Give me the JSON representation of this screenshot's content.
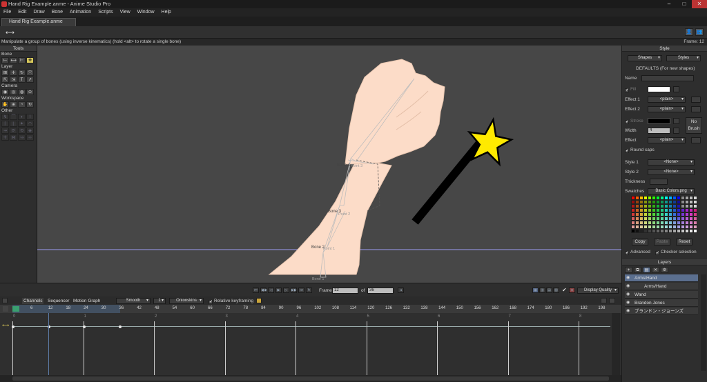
{
  "window": {
    "title": "Hand Rig Example.anme - Anime Studio Pro",
    "minimize": "–",
    "maximize": "□",
    "close": "✕"
  },
  "menu": [
    "File",
    "Edit",
    "Draw",
    "Bone",
    "Animation",
    "Scripts",
    "View",
    "Window",
    "Help"
  ],
  "doc_tab": "Hand Rig Example.anme",
  "status": {
    "message": "Manipulate a group of bones (using inverse kinematics) (hold <alt> to rotate a single bone)",
    "frame": "Frame: 12"
  },
  "tools": {
    "header": "Tools",
    "groups": [
      {
        "label": "Bone",
        "icons": [
          "⟝",
          "⟷",
          "⊢",
          "✥"
        ],
        "selected": 3
      },
      {
        "label": "Layer",
        "icons": [
          "⊞",
          "✛",
          "↻",
          "⤧",
          "⇱",
          "⇲",
          "T",
          "↗"
        ]
      },
      {
        "label": "Camera",
        "icons": [
          "◉",
          "◎",
          "◍",
          "⊙"
        ]
      },
      {
        "label": "Workspace",
        "icons": [
          "✋",
          "⊕",
          "◔",
          "↻"
        ]
      },
      {
        "label": "Other",
        "icons": [
          "↯",
          "⌒",
          "◗",
          "⌇",
          "⌈",
          "⌊",
          "✦",
          "◠",
          "⇝",
          "⟳",
          "⟲",
          "◈",
          "✛",
          "⋈",
          "↝",
          "⊹"
        ]
      }
    ]
  },
  "canvas": {
    "bones": [
      {
        "name": "Bone 4",
        "target": "Point 3"
      },
      {
        "name": "Bone 3",
        "target": "Point 2"
      },
      {
        "name": "Bone 2",
        "target": "Point 1"
      },
      {
        "name": "Bone 1",
        "target": ""
      }
    ],
    "colors": {
      "skin": "#fcdcc8",
      "star": "#ffea00",
      "wand": "#000000",
      "bg": "#474747",
      "bone": "#bdbdbd",
      "ground": "#8a8acf"
    }
  },
  "style_panel": {
    "header": "Style",
    "shapes_btn": "Shapes",
    "styles_btn": "Styles",
    "defaults": "DEFAULTS (For new shapes)",
    "name_label": "Name",
    "fill_label": "Fill",
    "effect1_label": "Effect 1",
    "effect1_value": "<plain>",
    "effect2_label": "Effect 2",
    "effect2_value": "<plain>",
    "stroke_label": "Stroke",
    "width_label": "Width",
    "width_value": "4",
    "effect_label": "Effect",
    "effect_value": "<plain>",
    "no_brush": "No Brush",
    "round_caps": "Round caps",
    "style1_label": "Style 1",
    "style1_value": "<None>",
    "style2_label": "Style 2",
    "style2_value": "<None>",
    "thickness_label": "Thickness",
    "swatches_label": "Swatches",
    "swatches_value": "Basic Colors.png",
    "copy_btn": "Copy",
    "paste_btn": "Paste",
    "reset_btn": "Reset",
    "advanced": "Advanced",
    "checker": "Checker selection"
  },
  "layers_panel": {
    "header": "Layers",
    "layers": [
      {
        "name": "Arms/Hand",
        "indent": 0,
        "selected": true
      },
      {
        "name": "Arms/Hand",
        "indent": 1,
        "selected": false
      },
      {
        "name": "Wand",
        "indent": 0,
        "selected": false
      },
      {
        "name": "Brandon Jones",
        "indent": 0,
        "selected": false
      },
      {
        "name": "ブランドン・ジョーンズ",
        "indent": 0,
        "selected": false
      }
    ]
  },
  "playbar": {
    "frame_label": "Frame",
    "frame_value": "12",
    "of_label": "of",
    "total_frames": "36",
    "display_quality": "Display Quality"
  },
  "timeline": {
    "tabs": [
      "Channels",
      "Sequencer",
      "Motion Graph"
    ],
    "interp": "Smooth",
    "interp_n": "1",
    "onionskins": "Onionskins",
    "relative_keyframing": "Relative keyframing",
    "ruler_labels": [
      "6",
      "12",
      "18",
      "24",
      "30",
      "36",
      "42",
      "48",
      "54",
      "60",
      "66",
      "72",
      "78",
      "84",
      "90",
      "96",
      "102",
      "108",
      "114",
      "120",
      "126",
      "132",
      "138",
      "144",
      "150",
      "156",
      "162",
      "168",
      "174",
      "180",
      "186",
      "192",
      "198"
    ],
    "seconds": [
      "0",
      "1",
      "2",
      "3",
      "4",
      "5",
      "6",
      "7",
      "8"
    ]
  }
}
